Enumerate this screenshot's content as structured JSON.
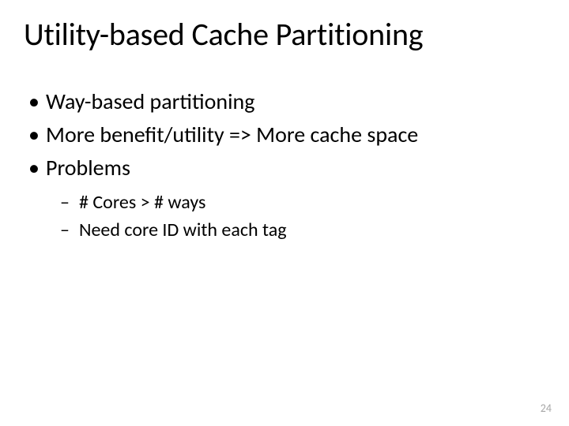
{
  "title": "Utility-based Cache Partitioning",
  "bullets": {
    "b0": "Way-based partitioning",
    "b1": "More benefit/utility => More cache space",
    "b2": "Problems",
    "sub": {
      "s0": "# Cores > # ways",
      "s1": "Need core ID with each tag"
    }
  },
  "page_number": "24"
}
